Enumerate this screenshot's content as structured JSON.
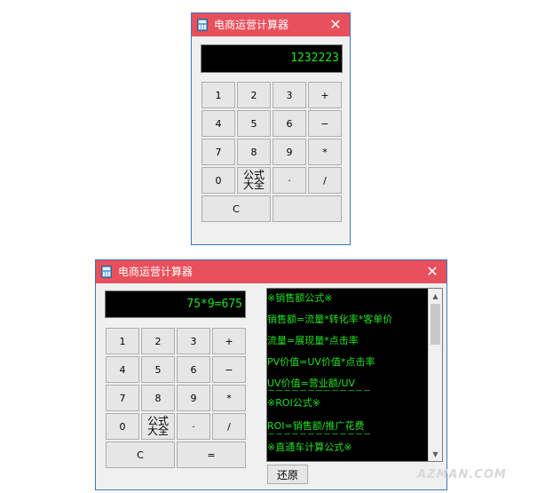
{
  "window_top": {
    "title": "电商运营计算器",
    "display": "1232223",
    "buttons": {
      "b1": "1",
      "b2": "2",
      "b3": "3",
      "plus": "+",
      "b4": "4",
      "b5": "5",
      "b6": "6",
      "minus": "−",
      "b7": "7",
      "b8": "8",
      "b9": "9",
      "mul": "*",
      "b0": "0",
      "formula": "公式\n大全",
      "dot": "·",
      "div": "/",
      "clear": "C",
      "equals": ""
    }
  },
  "window_bottom": {
    "title": "电商运营计算器",
    "display": "75*9=675",
    "buttons": {
      "b1": "1",
      "b2": "2",
      "b3": "3",
      "plus": "+",
      "b4": "4",
      "b5": "5",
      "b6": "6",
      "minus": "−",
      "b7": "7",
      "b8": "8",
      "b9": "9",
      "mul": "*",
      "b0": "0",
      "formula": "公式\n大全",
      "dot": "·",
      "div": "/",
      "clear": "C",
      "equals": "="
    },
    "formulas": [
      "※销售额公式※",
      "销售额=流量*转化率*客单价",
      "流量=展现量*点击率",
      "PV价值=UV价值*点击率",
      "UV价值=营业额/UV",
      "－－－－－－－－－－－－－",
      "※ROI公式※",
      "ROI=销售额/推广花费",
      "－－－－－－－－－－－－－",
      "※直通车计算公式※"
    ],
    "restore_label": "还原"
  },
  "watermark": "AZMAN.COM",
  "colors": {
    "titlebar": "#e8505b",
    "display_text": "#22e022",
    "display_bg": "#000000"
  }
}
